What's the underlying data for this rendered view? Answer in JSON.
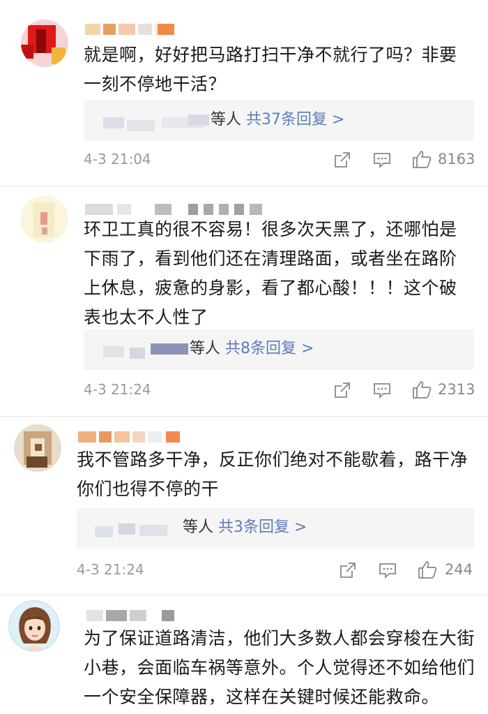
{
  "comments": [
    {
      "text": "就是啊，好好把马路打扫干净不就行了吗？非要一刻不停地干活？",
      "reply_suffix": "等人",
      "reply_count": "共37条回复 >",
      "time": "4-3 21:04",
      "likes": "8163"
    },
    {
      "text": "环卫工真的很不容易！很多次天黑了，还哪怕是下雨了，看到他们还在清理路面，或者坐在路阶上休息，疲惫的身影，看了都心酸！！！这个破表也太不人性了",
      "reply_suffix": "等人",
      "reply_count": "共8条回复 >",
      "time": "4-3 21:24",
      "likes": "2313"
    },
    {
      "text": "我不管路多干净，反正你们绝对不能歇着，路干净你们也得不停的干",
      "reply_suffix": "等人",
      "reply_count": "共3条回复 >",
      "time": "4-3 21:24",
      "likes": "244"
    },
    {
      "text": "为了保证道路清洁，他们大多数人都会穿梭在大街小巷，会面临车祸等意外。个人觉得还不如给他们一个安全保障器，这样在关键时候还能救命。"
    }
  ],
  "icons": [
    "share-icon",
    "comment-icon",
    "like-icon"
  ],
  "colors": {
    "reply_link": "#5b7eb8",
    "meta": "#9a9a9a",
    "reply_bg": "#f5f5f5"
  }
}
